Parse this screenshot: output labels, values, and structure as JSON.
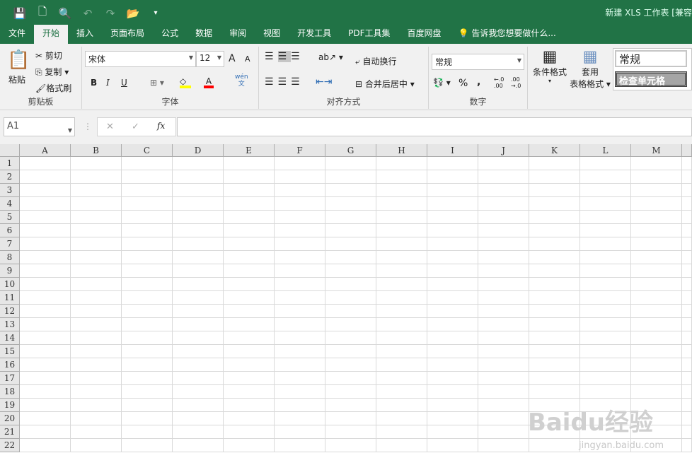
{
  "title": "新建 XLS 工作表  [兼容",
  "qat": {
    "save": "💾",
    "new": "🗋",
    "preview": "🔍",
    "undo": "↶",
    "redo": "↷",
    "open": "📂",
    "more": "▾"
  },
  "tabs": [
    "文件",
    "开始",
    "插入",
    "页面布局",
    "公式",
    "数据",
    "审阅",
    "视图",
    "开发工具",
    "PDF工具集",
    "百度网盘"
  ],
  "tell_me": "告诉我您想要做什么...",
  "clipboard": {
    "paste": "粘贴",
    "cut": "剪切",
    "copy": "复制",
    "format_painter": "格式刷",
    "label": "剪贴板"
  },
  "font": {
    "name": "宋体",
    "size": "12",
    "bold": "B",
    "italic": "I",
    "underline": "U",
    "grow": "A",
    "shrink": "A",
    "phonetic": "wén",
    "phonetic2": "文",
    "label": "字体",
    "fill_color": "#ffff00",
    "font_color": "#ff0000"
  },
  "alignment": {
    "wrap": "自动换行",
    "merge": "合并后居中",
    "label": "对齐方式"
  },
  "number": {
    "format": "常规",
    "percent": "%",
    "comma": ",",
    "inc": "←.0 .00",
    "dec": ".00 →.0",
    "label": "数字"
  },
  "styles": {
    "conditional": "条件格式",
    "table1": "套用",
    "table2": "表格格式",
    "normal": "常规",
    "check": "检查单元格"
  },
  "formula": {
    "namebox": "A1",
    "cancel": "✕",
    "enter": "✓",
    "fx": "fx",
    "value": ""
  },
  "columns": [
    "A",
    "B",
    "C",
    "D",
    "E",
    "F",
    "G",
    "H",
    "I",
    "J",
    "K",
    "L",
    "M"
  ],
  "rows": [
    "1",
    "2",
    "3",
    "4",
    "5",
    "6",
    "7",
    "8",
    "9",
    "10",
    "11",
    "12",
    "13",
    "14",
    "15",
    "16",
    "17",
    "18",
    "19",
    "20",
    "21",
    "22"
  ],
  "watermark": {
    "brand": "Baidu经验",
    "url": "jingyan.baidu.com"
  }
}
